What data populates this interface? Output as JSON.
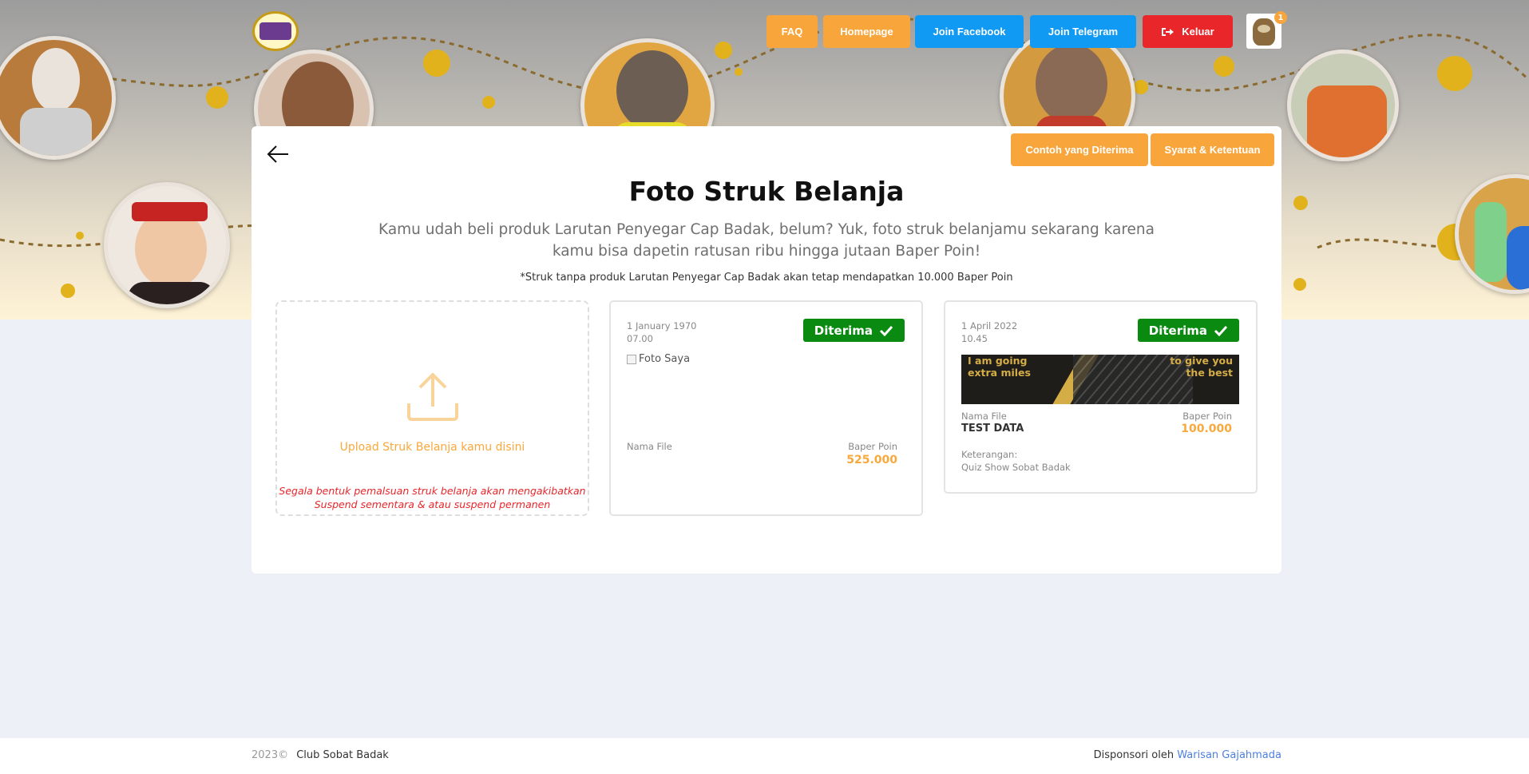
{
  "nav": {
    "faq": "FAQ",
    "homepage": "Homepage",
    "facebook": "Join Facebook",
    "telegram": "Join Telegram",
    "logout": "Keluar",
    "notification_count": "1"
  },
  "page": {
    "buttons": {
      "examples": "Contoh yang Diterima",
      "terms": "Syarat & Ketentuan"
    },
    "title": "Foto Struk Belanja",
    "subtitle": "Kamu udah beli produk Larutan Penyegar Cap Badak, belum? Yuk, foto struk belanjamu sekarang karena kamu bisa dapetin ratusan ribu hingga jutaan Baper Poin!",
    "note": "*Struk tanpa produk Larutan Penyegar Cap Badak akan tetap mendapatkan 10.000 Baper Poin"
  },
  "upload": {
    "label": "Upload Struk Belanja kamu disini",
    "warning_line1": "Segala bentuk pemalsuan struk belanja akan mengakibatkan",
    "warning_line2": "Suspend sementara & atau suspend permanen"
  },
  "receipts": [
    {
      "date": "1 January 1970",
      "time": "07.00",
      "status": "Diterima",
      "image_alt": "Foto Saya",
      "file_label": "Nama File",
      "file_name": "",
      "points_label": "Baper Poin",
      "points": "525.000"
    },
    {
      "date": "1 April 2022",
      "time": "10.45",
      "status": "Diterima",
      "image_text_left": "I am going extra miles",
      "image_text_left_1": "I am going",
      "image_text_left_2": "extra miles",
      "image_text_right_1": "to give you",
      "image_text_right_2": "the best",
      "file_label": "Nama File",
      "file_name": "TEST DATA",
      "points_label": "Baper Poin",
      "points": "100.000",
      "remark_label": "Keterangan:",
      "remark": "Quiz Show Sobat Badak"
    }
  ],
  "footer": {
    "year": "2023©",
    "brand": "Club Sobat Badak",
    "sponsor_prefix": "Disponsori oleh",
    "sponsor_link": "Warisan Gajahmada"
  },
  "colors": {
    "orange": "#f8a63c",
    "blue": "#109af4",
    "red": "#e9262a",
    "green": "#0a8a11",
    "link": "#4d7fe0"
  }
}
